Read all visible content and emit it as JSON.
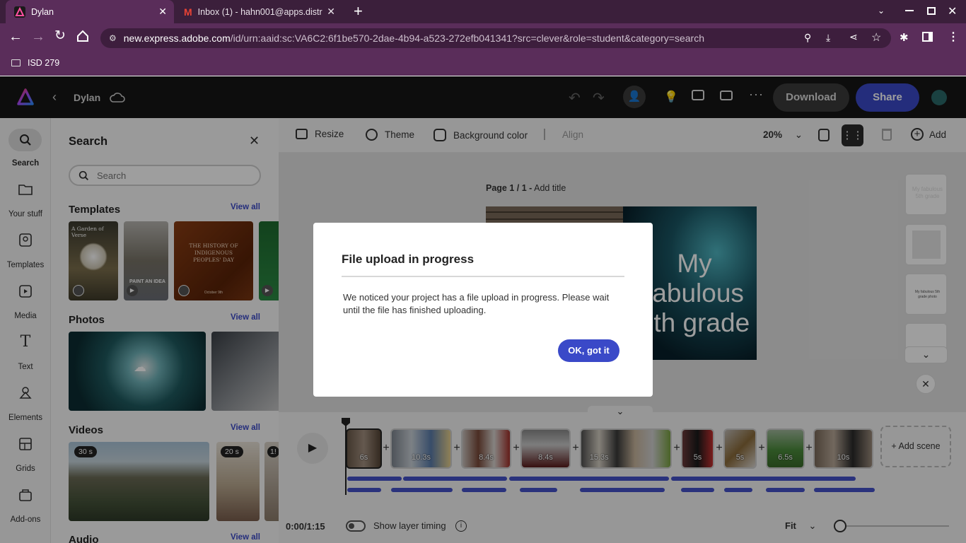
{
  "browser": {
    "tabs": [
      {
        "title": "Dylan",
        "active": true
      },
      {
        "title": "Inbox (1) - hahn001@apps.distr",
        "active": false
      }
    ],
    "url_host": "new.express.adobe.com",
    "url_path": "/id/urn:aaid:sc:VA6C2:6f1be570-2dae-4b94-a523-272efb041341?src=clever&role=student&category=search",
    "bookmark": "ISD 279"
  },
  "header": {
    "project_name": "Dylan",
    "download_label": "Download",
    "share_label": "Share"
  },
  "rail": {
    "items": [
      {
        "label": "Search",
        "icon": "search-icon"
      },
      {
        "label": "Your stuff",
        "icon": "folder-icon"
      },
      {
        "label": "Templates",
        "icon": "templates-icon"
      },
      {
        "label": "Media",
        "icon": "media-icon"
      },
      {
        "label": "Text",
        "icon": "text-icon"
      },
      {
        "label": "Elements",
        "icon": "elements-icon"
      },
      {
        "label": "Grids",
        "icon": "grids-icon"
      },
      {
        "label": "Add-ons",
        "icon": "addons-icon"
      }
    ]
  },
  "panel": {
    "title": "Search",
    "search_placeholder": "Search",
    "templates_title": "Templates",
    "photos_title": "Photos",
    "videos_title": "Videos",
    "audio_title": "Audio",
    "view_all": "View all",
    "template_texts": {
      "t1": "A Garden of Verse",
      "t2": "PAINT AN IDEA",
      "t3": "THE HISTORY OF INDIGENOUS PEOPLES' DAY",
      "t3_sub": "October 9th"
    },
    "video_durations": [
      "30 s",
      "20 s",
      "1!"
    ]
  },
  "canvas_toolbar": {
    "resize": "Resize",
    "theme": "Theme",
    "background_color": "Background color",
    "align": "Align",
    "zoom": "20%",
    "add": "Add"
  },
  "canvas": {
    "page_label": "Page 1 / 1 -",
    "add_title": "Add title",
    "slide_text": "My fabulous 5th grade",
    "page_thumb_texts": [
      "My fabulous 5th grade",
      "My fabulous 5th grade photo"
    ]
  },
  "timeline": {
    "time": "0:00/1:15",
    "show_layer_timing": "Show layer timing",
    "fit": "Fit",
    "add_scene": "+ Add scene",
    "scenes": [
      "6s",
      "10.3s",
      "8.4s",
      "8.4s",
      "15.3s",
      "5s",
      "5s",
      "6.5s",
      "10s"
    ]
  },
  "dialog": {
    "title": "File upload in progress",
    "body": "We noticed your project has a file upload in progress. Please wait until the file has finished uploading.",
    "ok_label": "OK, got it"
  },
  "colors": {
    "accent": "#3a49c8",
    "chrome_frame": "#3b1f3b",
    "app_header": "#161616"
  }
}
